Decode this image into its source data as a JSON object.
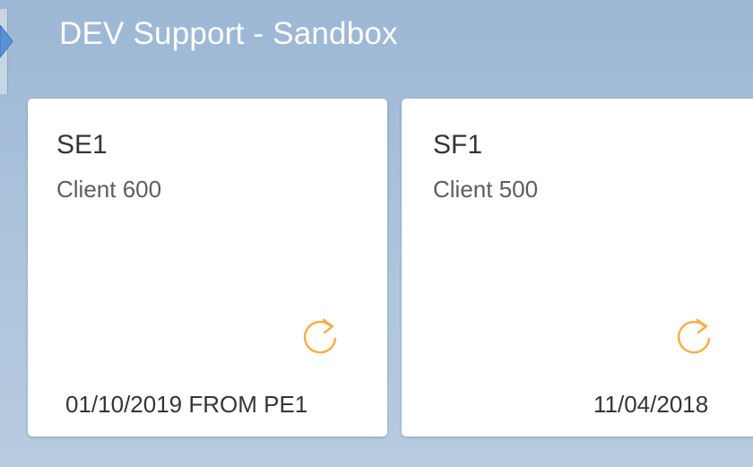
{
  "group": {
    "title": "DEV Support - Sandbox"
  },
  "tiles": [
    {
      "title": "SE1",
      "subtitle": "Client 600",
      "icon": "refresh-icon",
      "footer": "01/10/2019 FROM PE1"
    },
    {
      "title": "SF1",
      "subtitle": "Client 500",
      "icon": "refresh-icon",
      "footer": "11/04/2018"
    }
  ],
  "colors": {
    "header_background": "#a9c1da",
    "tile_background": "#ffffff",
    "icon_accent": "#f5b04a",
    "title_text": "#ffffff"
  }
}
